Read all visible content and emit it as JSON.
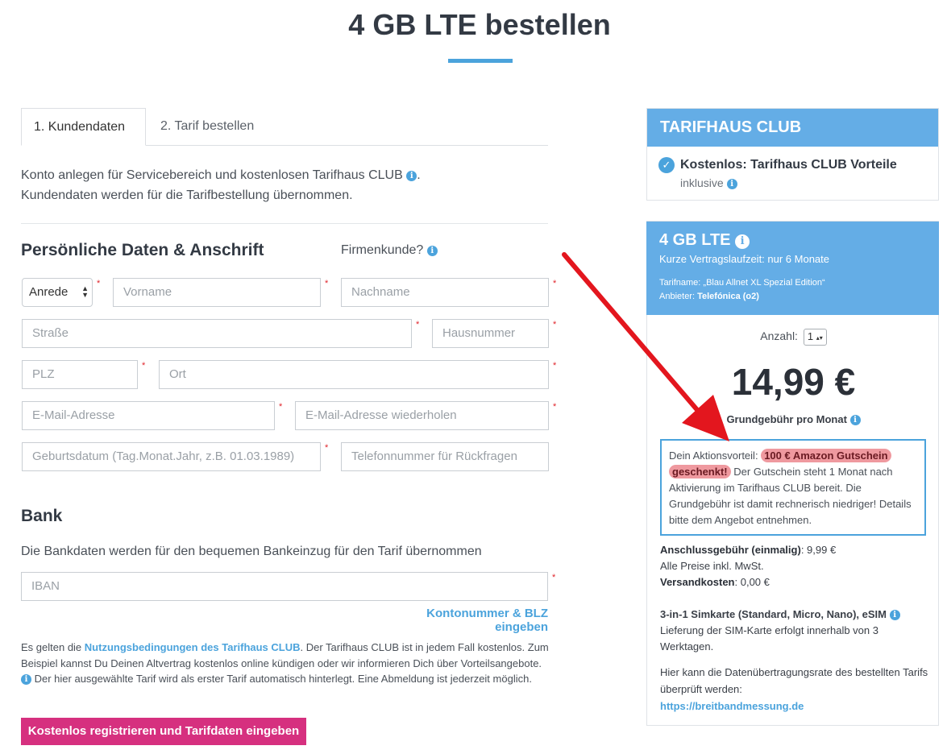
{
  "page": {
    "title": "4 GB LTE bestellen"
  },
  "tabs": [
    {
      "label": "1. Kundendaten",
      "active": true
    },
    {
      "label": "2. Tarif bestellen",
      "active": false
    }
  ],
  "intro": {
    "line1": "Konto anlegen für Servicebereich und kostenlosen Tarifhaus CLUB",
    "line2": "Kundendaten werden für die Tarifbestellung übernommen."
  },
  "personal": {
    "title": "Persönliche Daten & Anschrift",
    "firmenkunde": "Firmenkunde?",
    "salutation": "Anrede",
    "first_name": "Vorname",
    "last_name": "Nachname",
    "street": "Straße",
    "house_number": "Hausnummer",
    "zip": "PLZ",
    "city": "Ort",
    "email": "E-Mail-Adresse",
    "email_repeat": "E-Mail-Adresse wiederholen",
    "birthdate": "Geburtsdatum (Tag.Monat.Jahr, z.B. 01.03.1989)",
    "phone": "Telefonnummer für Rückfragen",
    "required_mark": "*"
  },
  "bank": {
    "title": "Bank",
    "description": "Die Bankdaten werden für den bequemen Bankeinzug für den Tarif übernommen",
    "iban": "IBAN",
    "alt_link": "Kontonummer & BLZ eingeben"
  },
  "terms": {
    "prefix": "Es gelten die",
    "link": "Nutzungsbedingungen des Tarifhaus CLUB",
    "text1": ". Der Tarifhaus CLUB ist in jedem Fall kostenlos. Zum Beispiel kannst Du Deinen Altvertrag kostenlos online kündigen oder wir informieren Dich über Vorteilsangebote.",
    "text2": "Der hier ausgewählte Tarif wird als erster Tarif automatisch hinterlegt. Eine Abmeldung ist jederzeit möglich."
  },
  "submit_label": "Kostenlos registrieren und Tarifdaten eingeben",
  "club": {
    "header": "TARIFHAUS CLUB",
    "benefit_title": "Kostenlos: Tarifhaus CLUB Vorteile",
    "benefit_sub": "inklusive"
  },
  "tariff": {
    "name": "4 GB LTE",
    "subtitle": "Kurze Vertragslaufzeit: nur 6 Monate",
    "tarifname_label": "Tarifname:",
    "tarifname": "„Blau Allnet XL Spezial Edition“",
    "provider_label": "Anbieter:",
    "provider": "Telefónica (o2)",
    "quantity_label": "Anzahl:",
    "quantity": "1",
    "price": "14,99 €",
    "price_sub": "Grundgebühr pro Monat",
    "promo_prefix": "Dein Aktionsvorteil:",
    "promo_highlight1": "100 € Amazon Gutschein",
    "promo_highlight2": "geschenkt!",
    "promo_text": "Der Gutschein steht 1 Monat nach Aktivierung im Tarifhaus CLUB bereit. Die Grundgebühr ist damit rechnerisch niedriger! Details bitte dem Angebot entnehmen.",
    "connection_label": "Anschlussgebühr (einmalig)",
    "connection_value": ": 9,99 €",
    "vat_note": "Alle Preise inkl. MwSt.",
    "shipping_label": "Versandkosten",
    "shipping_value": ": 0,00 €",
    "sim_title": "3-in-1 Simkarte (Standard, Micro, Nano), eSIM",
    "sim_text": "Lieferung der SIM-Karte erfolgt innerhalb von 3 Werktagen.",
    "rate_text": "Hier kann die Datenübertragungsrate des bestellten Tarifs überprüft werden:",
    "rate_link": "https://breitbandmessung.de"
  },
  "colors": {
    "accent": "#4ba3dc",
    "header_blue": "#64ade6",
    "submit": "#d6307f",
    "arrow": "#e3161e"
  }
}
